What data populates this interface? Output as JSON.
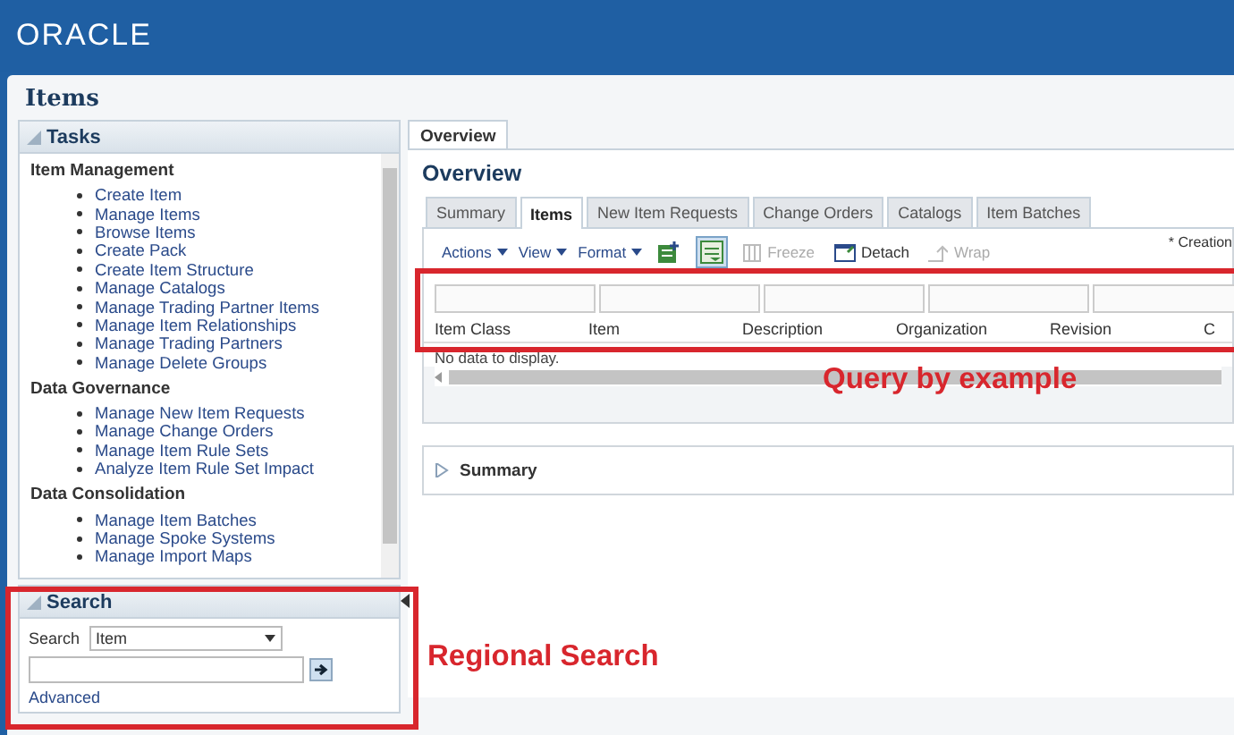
{
  "header": {
    "logo": "ORACLE"
  },
  "page_title": "Items",
  "tasks": {
    "title": "Tasks",
    "expanded": true,
    "groups": [
      {
        "title": "Item Management",
        "items": [
          "Create Item",
          "Manage Items",
          "Browse Items",
          "Create Pack",
          "Create Item Structure",
          "Manage Catalogs",
          "Manage Trading Partner Items",
          "Manage Item Relationships",
          "Manage Trading Partners",
          "Manage Delete Groups"
        ]
      },
      {
        "title": "Data Governance",
        "items": [
          "Manage New Item Requests",
          "Manage Change Orders",
          "Manage Item Rule Sets",
          "Analyze Item Rule Set Impact"
        ]
      },
      {
        "title": "Data Consolidation",
        "items": [
          "Manage Item Batches",
          "Manage Spoke Systems",
          "Manage Import Maps"
        ]
      }
    ]
  },
  "search_panel": {
    "title": "Search",
    "expanded": true,
    "label": "Search",
    "select_value": "Item",
    "advanced_link": "Advanced"
  },
  "main_tabs": [
    {
      "label": "Overview",
      "selected": true
    }
  ],
  "overview": {
    "title": "Overview",
    "tabs": [
      {
        "label": "Summary",
        "selected": false
      },
      {
        "label": "Items",
        "selected": true
      },
      {
        "label": "New Item Requests",
        "selected": false
      },
      {
        "label": "Change Orders",
        "selected": false
      },
      {
        "label": "Catalogs",
        "selected": false
      },
      {
        "label": "Item Batches",
        "selected": false
      }
    ],
    "menus": [
      "Actions",
      "View",
      "Format"
    ],
    "tools": [
      {
        "kind": "export",
        "selected": false
      },
      {
        "kind": "query",
        "selected": true
      },
      {
        "kind": "freeze",
        "label": "Freeze",
        "disabled": true
      },
      {
        "kind": "detach",
        "label": "Detach",
        "disabled": false
      },
      {
        "kind": "wrap",
        "label": "Wrap",
        "disabled": true
      }
    ],
    "note": "* Creation",
    "columns": [
      "Item Class",
      "Item",
      "Description",
      "Organization",
      "Revision",
      "C"
    ],
    "empty_message": "No data to display.",
    "summary": {
      "label": "Summary",
      "expanded": false
    }
  },
  "callouts": {
    "query_by_example": "Query by example",
    "regional_search": "Regional Search"
  }
}
